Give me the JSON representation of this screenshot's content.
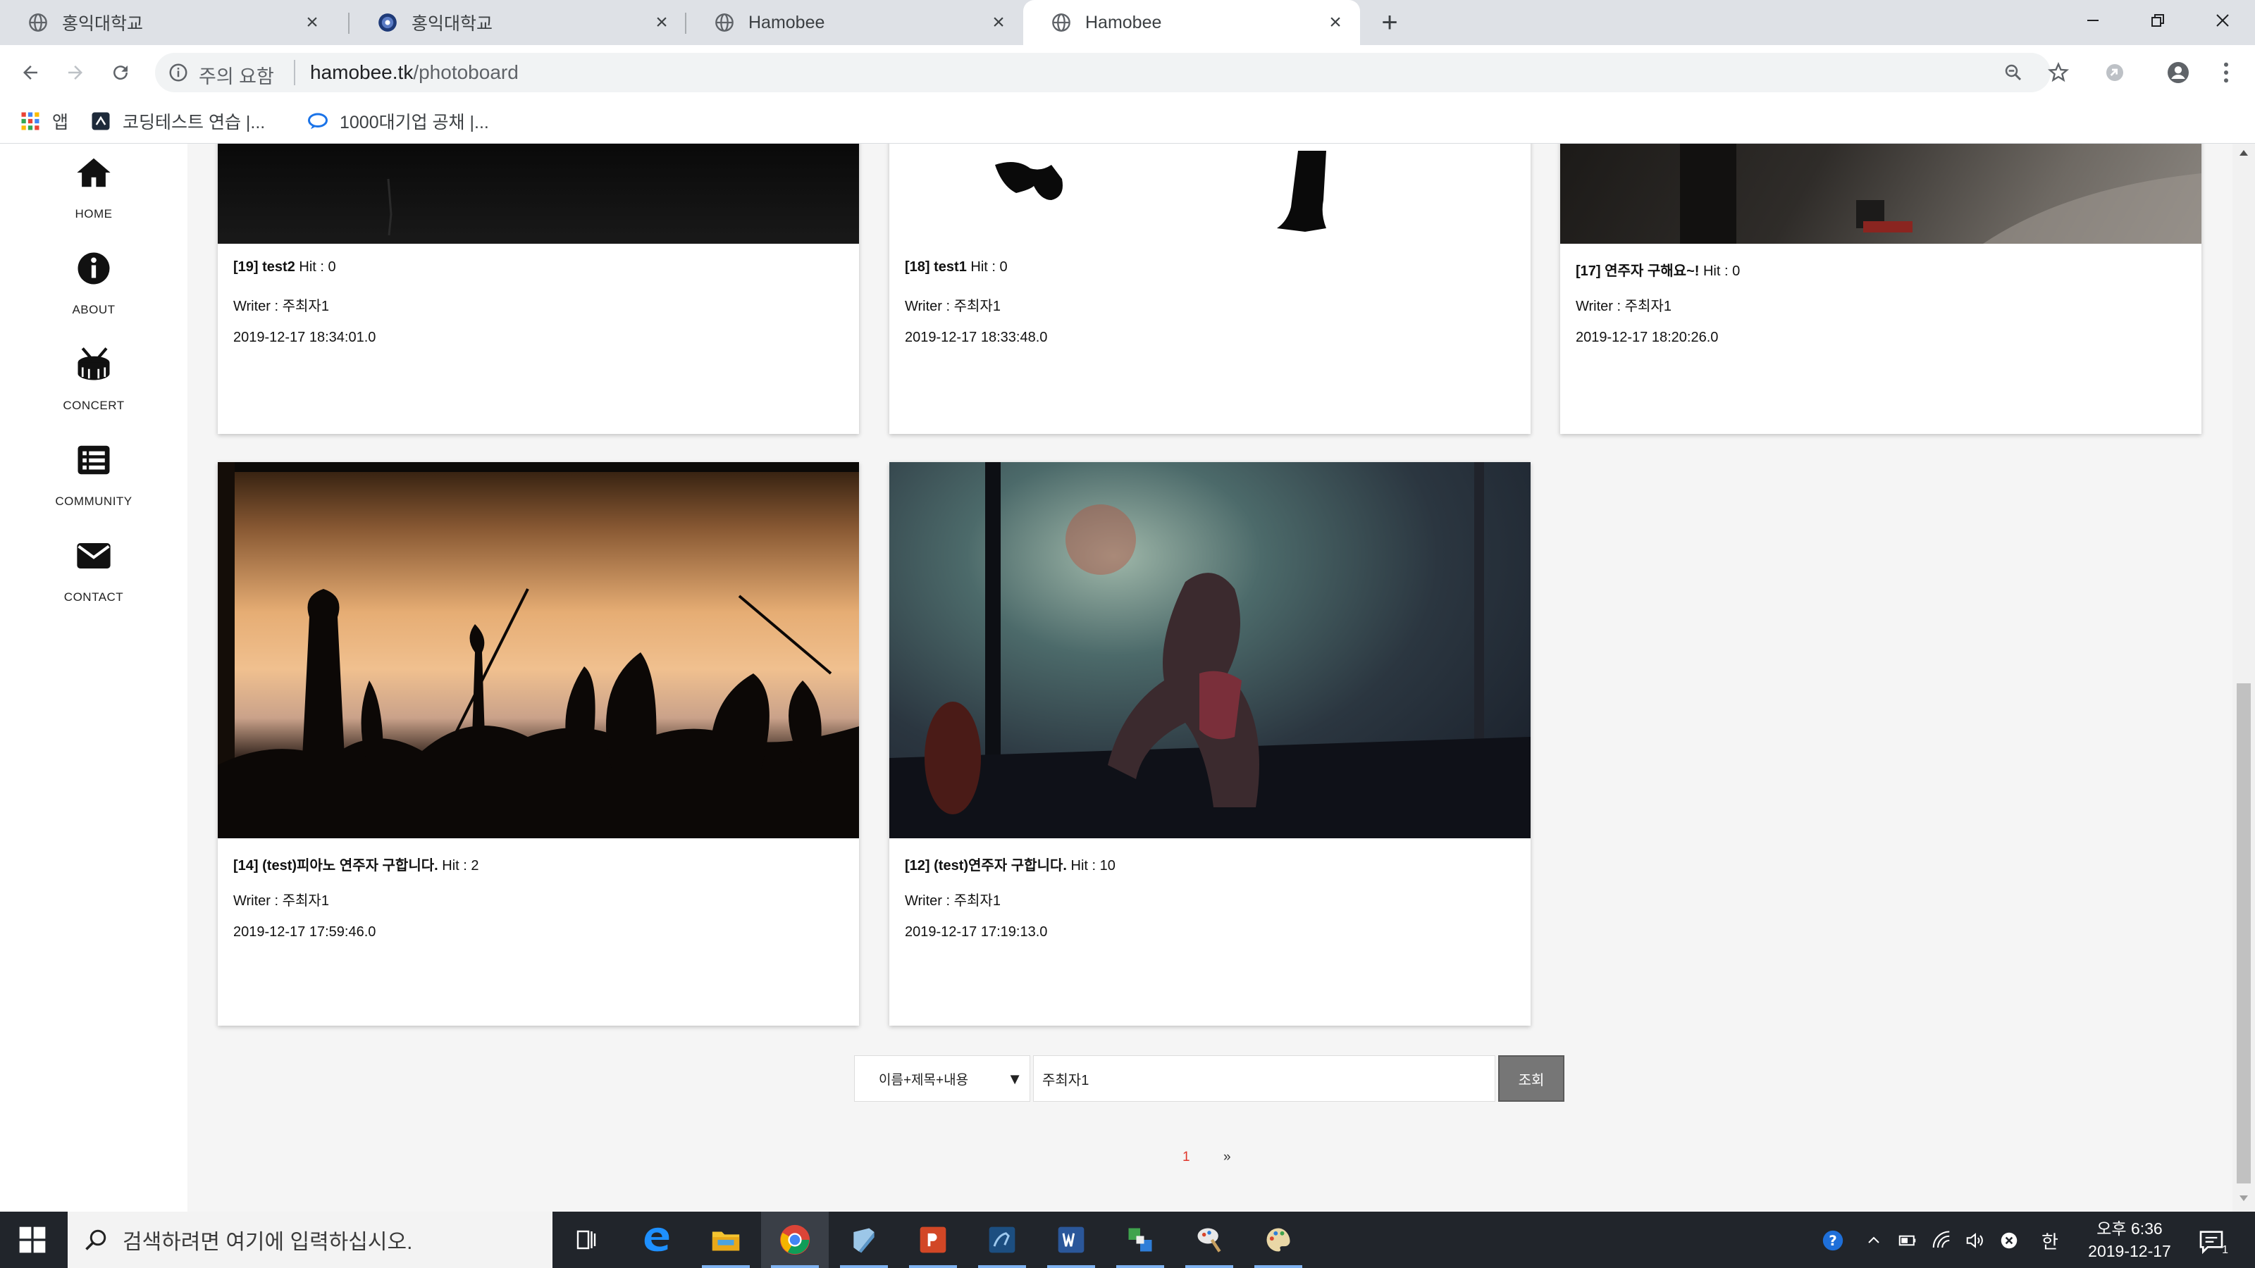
{
  "browser": {
    "tabs": [
      {
        "label": "홍익대학교",
        "active": false
      },
      {
        "label": "홍익대학교",
        "active": false
      },
      {
        "label": "Hamobee",
        "active": false
      },
      {
        "label": "Hamobee",
        "active": true
      }
    ],
    "security_label": "주의 요함",
    "url_host": "hamobee.tk",
    "url_path": "/photoboard",
    "bookmarks": [
      {
        "label": "앱",
        "icon": "apps-grid-icon"
      },
      {
        "label": "코딩테스트 연습 |...",
        "icon": "programmers-icon"
      },
      {
        "label": "1000대기업 공채 |...",
        "icon": "chat-bubble-icon"
      }
    ]
  },
  "sidebar": {
    "items": [
      {
        "label": "HOME",
        "icon": "home-icon"
      },
      {
        "label": "ABOUT",
        "icon": "info-icon"
      },
      {
        "label": "CONCERT",
        "icon": "drum-icon"
      },
      {
        "label": "COMMUNITY",
        "icon": "list-icon"
      },
      {
        "label": "CONTACT",
        "icon": "envelope-icon"
      }
    ]
  },
  "posts": [
    {
      "title": "[19] test2",
      "hit": "Hit : 0",
      "writer": "Writer : 주최자1",
      "date": "2019-12-17 18:34:01.0"
    },
    {
      "title": "[18] test1",
      "hit": "Hit : 0",
      "writer": "Writer : 주최자1",
      "date": "2019-12-17 18:33:48.0"
    },
    {
      "title": "[17] 연주자 구해요~!",
      "hit": "Hit : 0",
      "writer": "Writer : 주최자1",
      "date": "2019-12-17 18:20:26.0"
    },
    {
      "title": "[14] (test)피아노 연주자 구합니다.",
      "hit": "Hit : 2",
      "writer": "Writer : 주최자1",
      "date": "2019-12-17 17:59:46.0"
    },
    {
      "title": "[12] (test)연주자 구합니다.",
      "hit": "Hit : 10",
      "writer": "Writer : 주최자1",
      "date": "2019-12-17 17:19:13.0"
    }
  ],
  "search": {
    "filter_selected": "이름+제목+내용",
    "query": "주최자1",
    "button_label": "조회"
  },
  "pagination": {
    "current": "1",
    "next": "»"
  },
  "taskbar": {
    "search_placeholder": "검색하려면 여기에 입력하십시오.",
    "time": "오후 6:36",
    "date": "2019-12-17",
    "ime": "한",
    "notification_count": "1"
  },
  "colors": {
    "accent_pagination": "#e0352b",
    "taskbar_bg": "#21252b",
    "search_button": "#767676"
  }
}
